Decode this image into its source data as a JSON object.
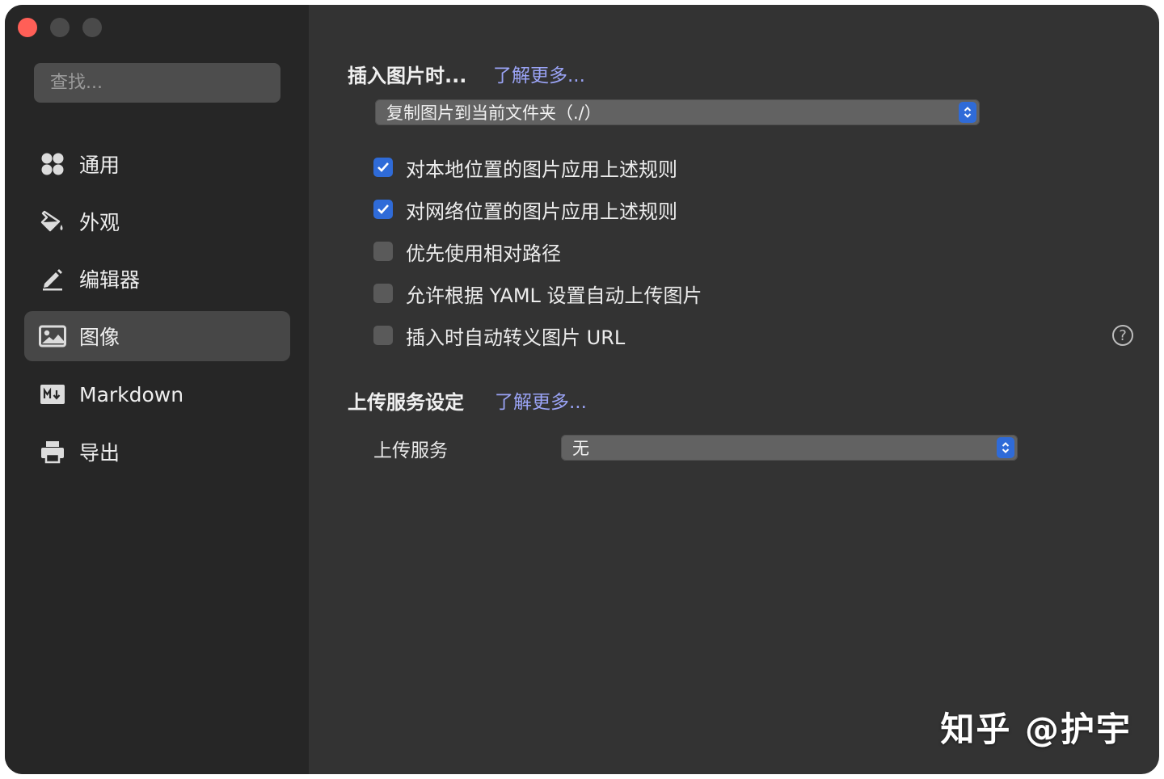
{
  "sidebar": {
    "search_placeholder": "查找...",
    "items": [
      {
        "label": "通用",
        "icon": "grid-icon"
      },
      {
        "label": "外观",
        "icon": "paint-bucket-icon"
      },
      {
        "label": "编辑器",
        "icon": "pencil-icon"
      },
      {
        "label": "图像",
        "icon": "image-icon",
        "selected": true
      },
      {
        "label": "Markdown",
        "icon": "markdown-icon"
      },
      {
        "label": "导出",
        "icon": "printer-icon"
      }
    ]
  },
  "insert_image": {
    "title": "插入图片时...",
    "learn_more": "了解更多...",
    "action_value": "复制图片到当前文件夹（./）",
    "options": [
      {
        "label": "对本地位置的图片应用上述规则",
        "checked": true
      },
      {
        "label": "对网络位置的图片应用上述规则",
        "checked": true
      },
      {
        "label": "优先使用相对路径",
        "checked": false
      },
      {
        "label": "允许根据 YAML 设置自动上传图片",
        "checked": false
      },
      {
        "label": "插入时自动转义图片 URL",
        "checked": false
      }
    ],
    "help_symbol": "?"
  },
  "upload": {
    "title": "上传服务设定",
    "learn_more": "了解更多...",
    "service_label": "上传服务",
    "service_value": "无"
  },
  "watermark": "知乎 @护宇",
  "colors": {
    "accent": "#2f6bd8",
    "link": "#9aa3f5",
    "sidebar_bg": "#262626",
    "content_bg": "#333333",
    "close": "#ff5f57"
  }
}
